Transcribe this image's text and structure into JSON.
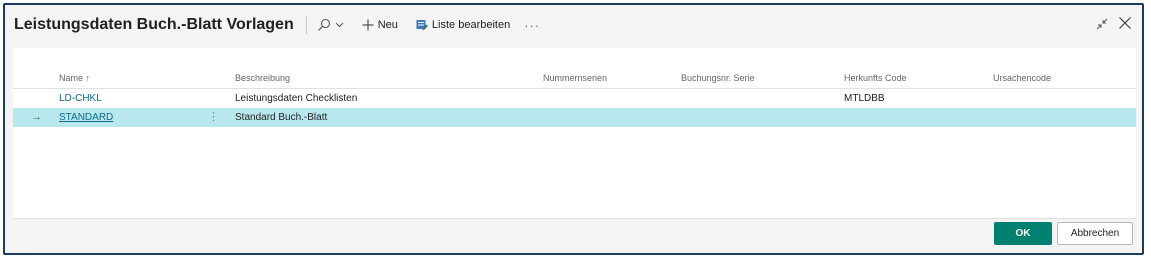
{
  "header": {
    "title": "Leistungsdaten Buch.-Blatt Vorlagen",
    "new_label": "Neu",
    "edit_list_label": "Liste bearbeiten",
    "more_label": "···"
  },
  "columns": {
    "name": "Name ↑",
    "beschreibung": "Beschreibung",
    "nummernserien": "Nummernserien",
    "buchungsnr_serie": "Buchungsnr. Serie",
    "herkunfts_code": "Herkunfts Code",
    "ursachencode": "Ursachencode"
  },
  "rows": [
    {
      "name": "LD-CHKL",
      "beschreibung": "Leistungsdaten Checklisten",
      "herkunfts_code": "MTLDBB"
    },
    {
      "name": "STANDARD",
      "beschreibung": "Standard Buch.-Blatt",
      "herkunfts_code": "",
      "selected": true,
      "row_arrow": "→",
      "menu": "⋮"
    }
  ],
  "footer": {
    "ok_label": "OK",
    "cancel_label": "Abbrechen"
  },
  "colors": {
    "accent": "#00806e",
    "selected_row": "#b8e8ee",
    "link": "#0b6a8a"
  }
}
